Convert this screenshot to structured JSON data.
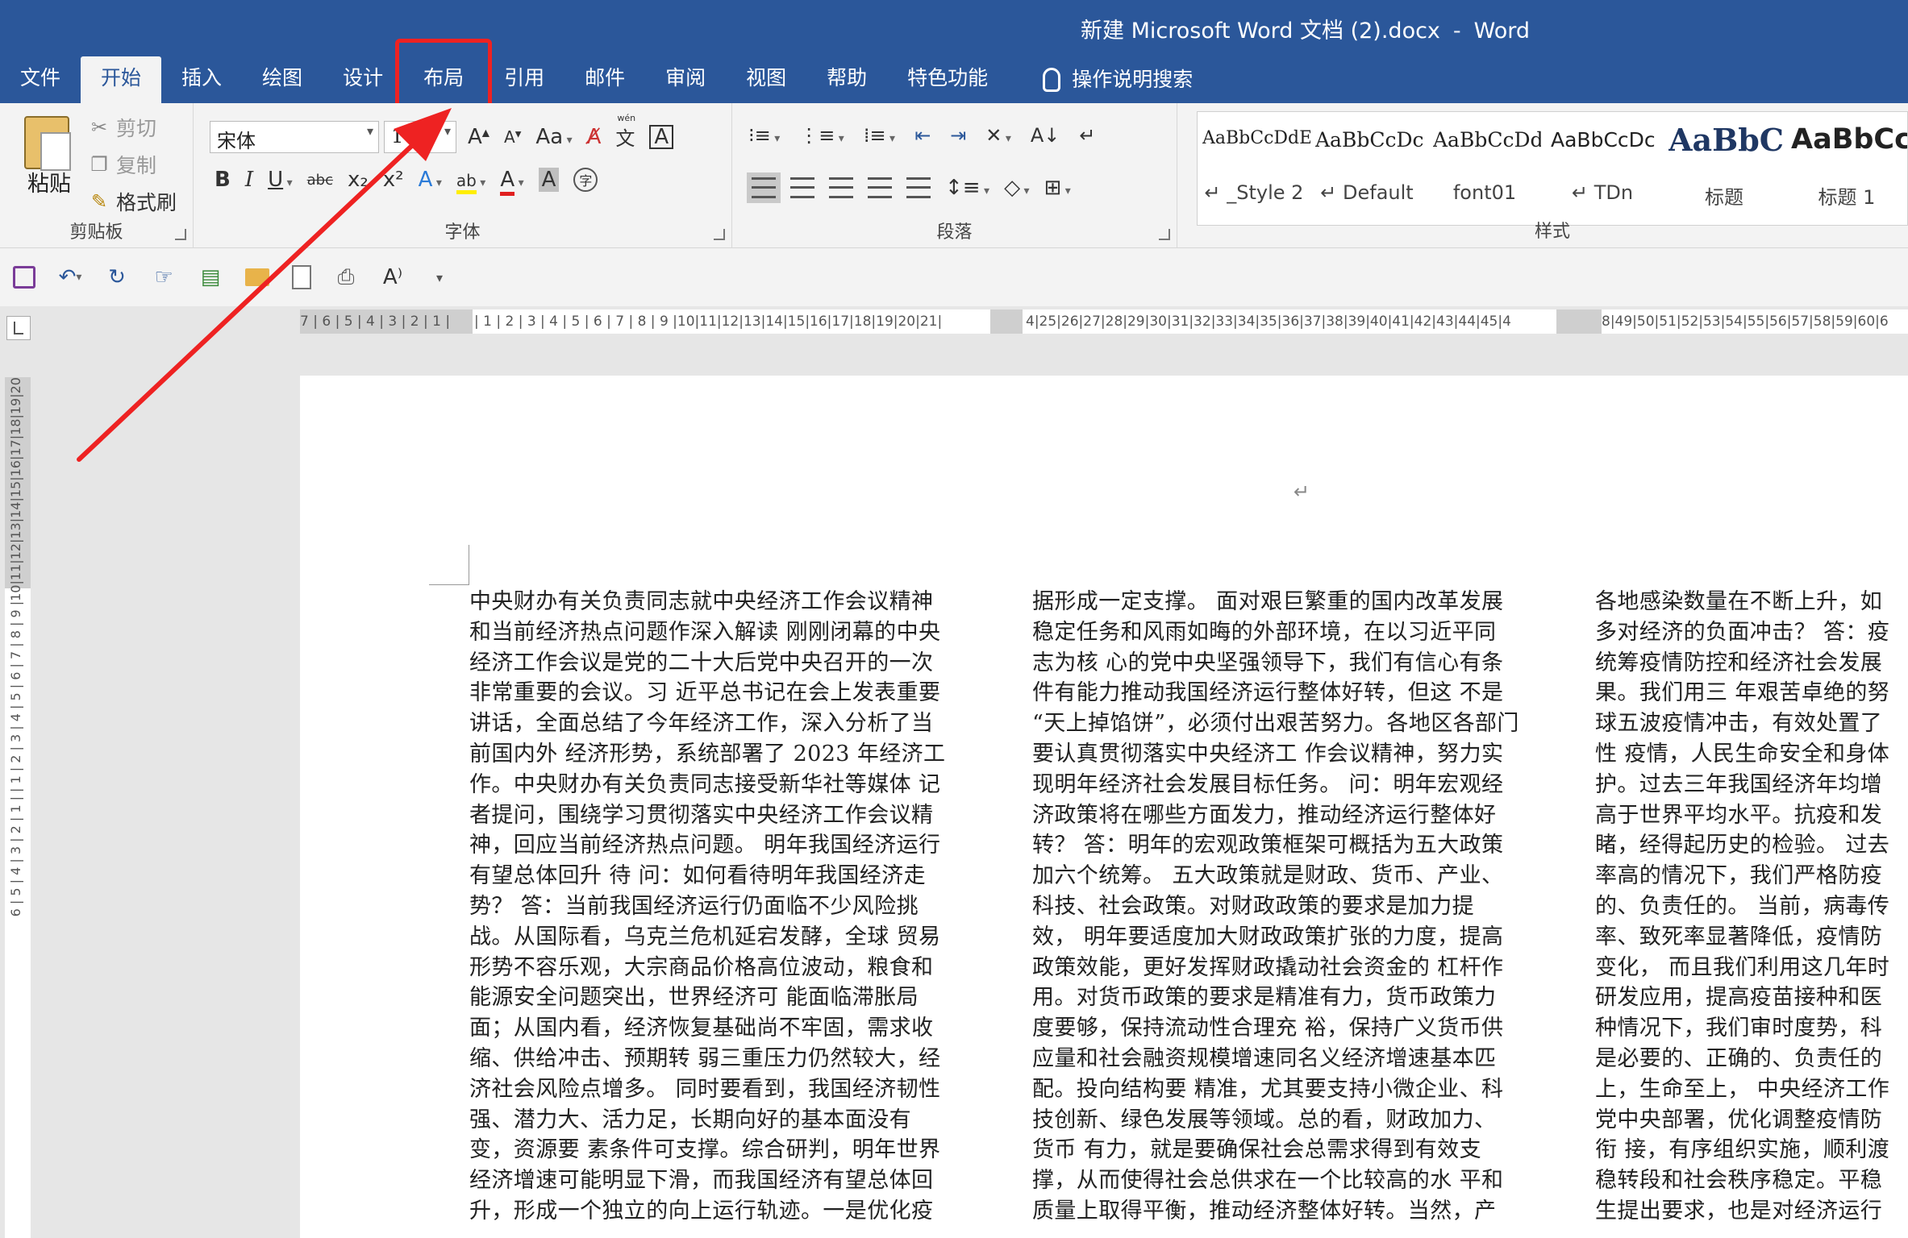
{
  "window": {
    "title": "新建 Microsoft Word 文档 (2).docx",
    "separator": "-",
    "app": "Word"
  },
  "tabs": [
    "文件",
    "开始",
    "插入",
    "绘图",
    "设计",
    "布局",
    "引用",
    "邮件",
    "审阅",
    "视图",
    "帮助",
    "特色功能"
  ],
  "active_tab": "开始",
  "highlighted_tab": "布局",
  "tell_me": "操作说明搜索",
  "clipboard": {
    "paste": "粘贴",
    "cut": "剪切",
    "copy": "复制",
    "format_painter": "格式刷",
    "label": "剪贴板"
  },
  "font": {
    "name": "宋体",
    "size": "10",
    "label": "字体",
    "aa": "Aa",
    "pinyin_top": "wén",
    "pinyin_char": "文",
    "border_char": "A",
    "x2": "x₂",
    "xsup": "x²"
  },
  "paragraph": {
    "label": "段落"
  },
  "styles": {
    "label": "样式",
    "items": [
      {
        "sample": "AaBbCcDdE",
        "name": "↵ _Style 2"
      },
      {
        "sample": "AaBbCcDc",
        "name": "↵ Default"
      },
      {
        "sample": "AaBbCcDd",
        "name": "font01"
      },
      {
        "sample": "AaBbCcDc",
        "name": "↵ TDn"
      },
      {
        "sample": "AaBbC",
        "name": "标题"
      },
      {
        "sample": "AaBbCc",
        "name": "标题 1"
      }
    ]
  },
  "ruler": {
    "left_text": "7 | 6 | 5 | 4 | 3 | 2 | 1 |",
    "main_text": "| 1 | 2 | 3 | 4 | 5 | 6 | 7 | 8 | 9 |10|11|12|13|14|15|16|17|18|19|20|21|",
    "mid_text": "4|25|26|27|28|29|30|31|32|33|34|35|36|37|38|39|40|41|42|43|44|45|4",
    "right_text": "8|49|50|51|52|53|54|55|56|57|58|59|60|6",
    "vertical_text": "6 | 5 | 4 | 3 | 2 | 1 |   | 1 | 2 | 3 | 4 | 5 | 6 | 7 | 8 | 9 |10|11|12|13|14|15|16|17|18|19|20"
  },
  "page": {
    "return_mark": "↵"
  },
  "columns": {
    "col1": [
      "中央财办有关负责同志就中央经济工作会议精神",
      "和当前经济热点问题作深入解读  刚刚闭幕的中央",
      "经济工作会议是党的二十大后党中央召开的一次",
      "非常重要的会议。习  近平总书记在会上发表重要",
      "讲话，全面总结了今年经济工作，深入分析了当",
      "前国内外  经济形势，系统部署了 2023 年经济工",
      "作。中央财办有关负责同志接受新华社等媒体  记",
      "者提问，围绕学习贯彻落实中央经济工作会议精",
      "神，回应当前经济热点问题。  明年我国经济运行",
      "有望总体回升  待  问：如何看待明年我国经济走",
      "势？  答：当前我国经济运行仍面临不少风险挑",
      "战。从国际看，乌克兰危机延宕发酵，全球  贸易",
      "形势不容乐观，大宗商品价格高位波动，粮食和",
      "能源安全问题突出，世界经济可  能面临滞胀局",
      "面；从国内看，经济恢复基础尚不牢固，需求收",
      "缩、供给冲击、预期转  弱三重压力仍然较大，经",
      "济社会风险点增多。  同时要看到，我国经济韧性",
      "强、潜力大、活力足，长期向好的基本面没有",
      "变，资源要  素条件可支撑。综合研判，明年世界",
      "经济增速可能明显下滑，而我国经济有望总体回",
      "升，形成一个独立的向上运行轨迹。一是优化疫"
    ],
    "col2": [
      "据形成一定支撑。  面对艰巨繁重的国内改革发展",
      "稳定任务和风雨如晦的外部环境，在以习近平同",
      "志为核  心的党中央坚强领导下，我们有信心有条",
      "件有能力推动我国经济运行整体好转，但这  不是",
      "“天上掉馅饼”，必须付出艰苦努力。各地区各部门",
      "要认真贯彻落实中央经济工  作会议精神，努力实",
      "现明年经济社会发展目标任务。  问：明年宏观经",
      "济政策将在哪些方面发力，推动经济运行整体好",
      "转？  答：明年的宏观政策框架可概括为五大政策",
      "加六个统筹。  五大政策就是财政、货币、产业、",
      "科技、社会政策。对财政政策的要求是加力提",
      "效，  明年要适度加大财政政策扩张的力度，提高",
      "政策效能，更好发挥财政撬动社会资金的  杠杆作",
      "用。对货币政策的要求是精准有力，货币政策力",
      "度要够，保持流动性合理充  裕，保持广义货币供",
      "应量和社会融资规模增速同名义经济增速基本匹",
      "配。投向结构要  精准，尤其要支持小微企业、科",
      "技创新、绿色发展等领域。总的看，财政加力、",
      "货币  有力，就是要确保社会总需求得到有效支",
      "撑，从而使得社会总供求在一个比较高的水  平和",
      "质量上取得平衡，推动经济整体好转。当然，产"
    ],
    "col3": [
      "各地感染数量在不断上升，如",
      "多对经济的负面冲击？  答：疫",
      "统筹疫情防控和经济社会发展",
      "果。我们用三  年艰苦卓绝的努",
      "球五波疫情冲击，有效处置了",
      "性  疫情，人民生命安全和身体",
      "护。过去三年我国经济年均增",
      "高于世界平均水平。抗疫和发",
      "睹，经得起历史的检验。  过去",
      "率高的情况下，我们严格防疫",
      "的、负责任的。  当前，病毒传",
      "率、致死率显著降低，疫情防",
      "变化，  而且我们利用这几年时",
      "研发应用，提高疫苗接种和医",
      "种情况下，我们审时度势，科",
      "是必要的、正确的、负责任的",
      "上，生命至上，  中央经济工作",
      "党中央部署，优化调整疫情防",
      "衔  接，有序组织实施，顺利渡",
      "稳转段和社会秩序稳定。平稳",
      "生提出要求，也是对经济运行"
    ]
  }
}
